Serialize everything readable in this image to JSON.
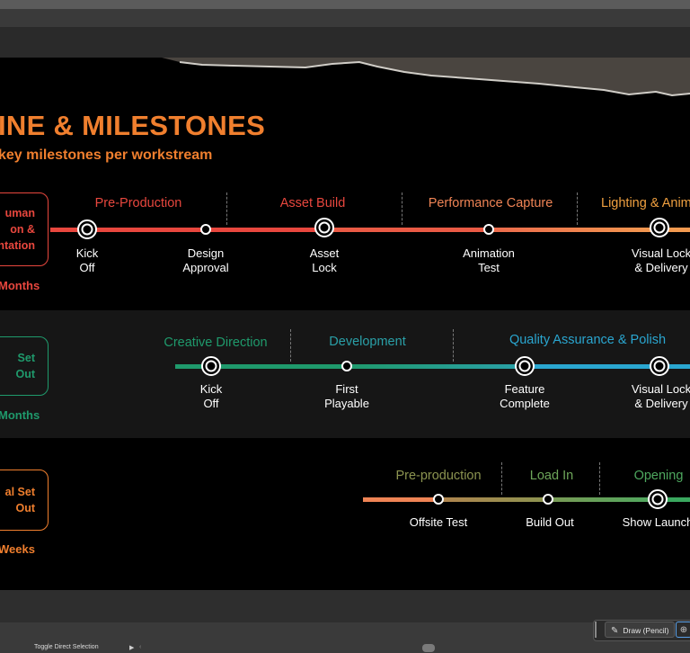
{
  "slide": {
    "title": "INE & MILESTONES",
    "subtitle": "key milestones per workstream"
  },
  "colors": {
    "orange": "#f07f2e",
    "red": "#e8473e",
    "salmon": "#ef8455",
    "green": "#1f9a6c",
    "teal": "#2aa0a8",
    "blue": "#2aa6d0",
    "olive": "#8c9450",
    "gold": "#f0a040"
  },
  "workstreams": [
    {
      "box_lines": [
        "uman",
        "on &",
        "ntation"
      ],
      "duration": "Months",
      "phases": [
        "Pre-Production",
        "Asset Build",
        "Performance Capture",
        "Lighting & Anim"
      ],
      "milestones": [
        {
          "lines": [
            "Kick",
            "Off"
          ]
        },
        {
          "lines": [
            "Design",
            "Approval"
          ]
        },
        {
          "lines": [
            "Asset",
            "Lock"
          ]
        },
        {
          "lines": [
            "Animation",
            "Test"
          ]
        },
        {
          "lines": [
            "Visual Lock",
            "& Delivery"
          ]
        }
      ]
    },
    {
      "box_lines": [
        "Set",
        "Out"
      ],
      "duration": "Months",
      "phases": [
        "Creative Direction",
        "Development",
        "Quality Assurance & Polish"
      ],
      "milestones": [
        {
          "lines": [
            "Kick",
            "Off"
          ]
        },
        {
          "lines": [
            "First",
            "Playable"
          ]
        },
        {
          "lines": [
            "Feature",
            "Complete"
          ]
        },
        {
          "lines": [
            "Visual Lock",
            "& Delivery"
          ]
        }
      ]
    },
    {
      "box_lines": [
        "al Set",
        "Out"
      ],
      "duration": "Weeks",
      "phases": [
        "Pre-production",
        "Load In",
        "Opening"
      ],
      "milestones": [
        {
          "lines": [
            "Offsite Test"
          ]
        },
        {
          "lines": [
            "Build Out"
          ]
        },
        {
          "lines": [
            "Show Launch"
          ]
        }
      ]
    }
  ],
  "toolbar": {
    "draw_label": "Draw (Pencil)",
    "tooltip": "Toggle Direct Selection"
  },
  "icons": {
    "pencil": "pencil-icon",
    "play": "play-icon",
    "scroll_left": "scroll-left-icon",
    "extra": "add-layer-icon"
  }
}
